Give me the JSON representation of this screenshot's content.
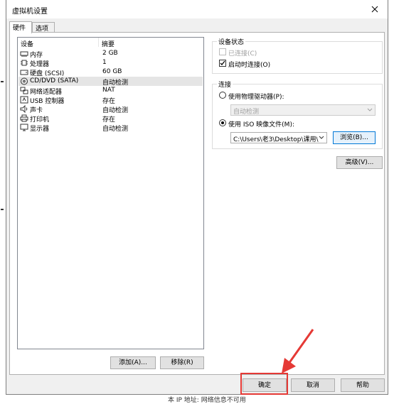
{
  "window": {
    "title": "虚拟机设置"
  },
  "tabs": [
    {
      "label": "硬件"
    },
    {
      "label": "选项"
    }
  ],
  "device_list": {
    "headers": {
      "device": "设备",
      "summary": "摘要"
    },
    "rows": [
      {
        "icon": "memory-icon",
        "name": "内存",
        "value": "2 GB"
      },
      {
        "icon": "cpu-icon",
        "name": "处理器",
        "value": "1"
      },
      {
        "icon": "hard-disk-icon",
        "name": "硬盘 (SCSI)",
        "value": "60 GB"
      },
      {
        "icon": "cd-dvd-icon",
        "name": "CD/DVD (SATA)",
        "value": "自动检测"
      },
      {
        "icon": "network-adapter-icon",
        "name": "网络适配器",
        "value": "NAT"
      },
      {
        "icon": "usb-icon",
        "name": "USB 控制器",
        "value": "存在"
      },
      {
        "icon": "sound-card-icon",
        "name": "声卡",
        "value": "自动检测"
      },
      {
        "icon": "printer-icon",
        "name": "打印机",
        "value": "存在"
      },
      {
        "icon": "display-icon",
        "name": "显示器",
        "value": "自动检测"
      }
    ],
    "selected_index": 3
  },
  "list_buttons": {
    "add": "添加(A)...",
    "remove": "移除(R)"
  },
  "device_status": {
    "title": "设备状态",
    "connected": {
      "label": "已连接(C)",
      "checked": false,
      "enabled": false
    },
    "connect_on_power": {
      "label": "启动时连接(O)",
      "checked": true
    }
  },
  "connection": {
    "title": "连接",
    "physical_drive": {
      "label": "使用物理驱动器(P):",
      "selected": false
    },
    "physical_drive_value": "自动检测",
    "iso_image": {
      "label": "使用 ISO 映像文件(M):",
      "selected": true
    },
    "iso_path": "C:\\Users\\老3\\Desktop\\课用\\",
    "browse": "浏览(B)..."
  },
  "advanced_button": "高级(V)...",
  "footer": {
    "ok": "确定",
    "cancel": "取消",
    "help": "帮助"
  },
  "background_text": "本 IP 地址: 网络信息不可用",
  "colors": {
    "highlight_box": "#e53935",
    "selected_row": "#e5e5e5",
    "focus_border": "#0078d7"
  }
}
